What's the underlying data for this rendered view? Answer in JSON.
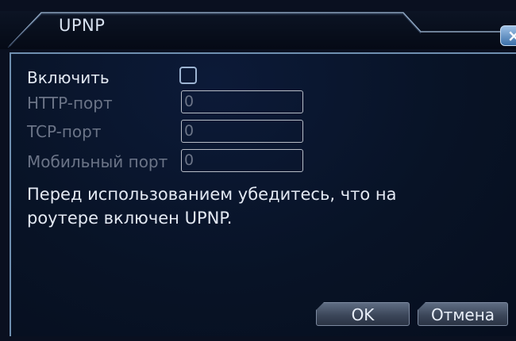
{
  "dialog": {
    "title": "UPNP",
    "close_glyph": "×"
  },
  "form": {
    "enable_label": "Включить",
    "enable_checked": false,
    "http_port_label": "HTTP-порт",
    "http_port_value": "0",
    "tcp_port_label": "TCP-порт",
    "tcp_port_value": "0",
    "mobile_port_label": "Мобильный порт",
    "mobile_port_value": "0",
    "notice": "Перед использованием убедитесь, что на роутере включен  UPNP."
  },
  "buttons": {
    "ok_label": "OK",
    "cancel_label": "Отмена"
  },
  "colors": {
    "background": "#0a1020",
    "active_text": "#e3e9f3",
    "disabled_text": "#6b7487",
    "border": "#6f8fb0"
  }
}
